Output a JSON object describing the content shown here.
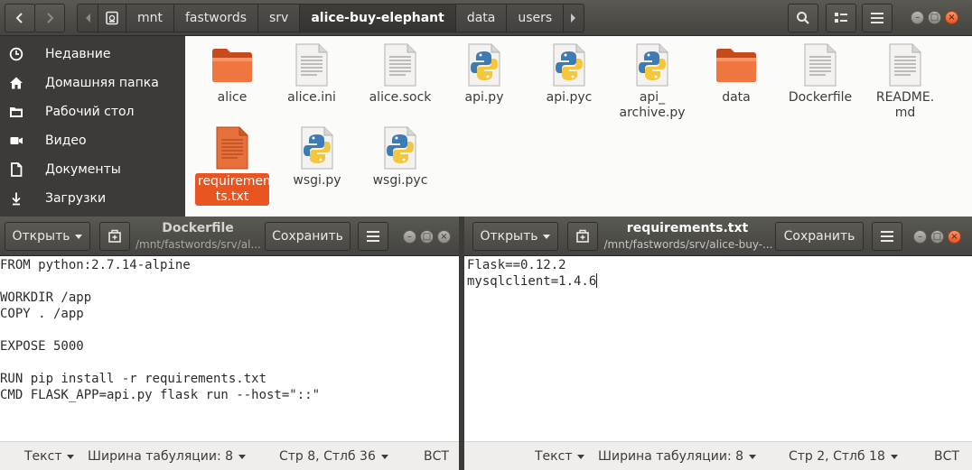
{
  "files_window": {
    "breadcrumbs": [
      "mnt",
      "fastwords",
      "srv",
      "alice-buy-elephant",
      "data",
      "users"
    ],
    "active_crumb": "alice-buy-elephant",
    "sidebar": [
      {
        "label": "Недавние",
        "icon": "clock-icon"
      },
      {
        "label": "Домашняя папка",
        "icon": "home-icon"
      },
      {
        "label": "Рабочий стол",
        "icon": "desktop-folder-icon"
      },
      {
        "label": "Видео",
        "icon": "video-icon"
      },
      {
        "label": "Документы",
        "icon": "document-icon"
      },
      {
        "label": "Загрузки",
        "icon": "download-icon"
      }
    ],
    "files": [
      {
        "name": "alice",
        "type": "folder"
      },
      {
        "name": "alice.ini",
        "type": "text"
      },
      {
        "name": "alice.sock",
        "type": "text"
      },
      {
        "name": "api.py",
        "type": "python"
      },
      {
        "name": "api.pyc",
        "type": "python"
      },
      {
        "name": "api_\narchive.py",
        "type": "python"
      },
      {
        "name": "data",
        "type": "folder"
      },
      {
        "name": "Dockerfile",
        "type": "text"
      },
      {
        "name": "README.\nmd",
        "type": "text"
      },
      {
        "name": "requiremen\nts.txt",
        "type": "text-selected"
      },
      {
        "name": "wsgi.py",
        "type": "python"
      },
      {
        "name": "wsgi.pyc",
        "type": "python"
      }
    ]
  },
  "editor_left": {
    "open_label": "Открыть",
    "save_label": "Сохранить",
    "title": "Dockerfile",
    "subtitle": "/mnt/fastwords/srv/al...",
    "content": "FROM python:2.7.14-alpine\n\nWORKDIR /app\nCOPY . /app\n\nEXPOSE 5000\n\nRUN pip install -r requirements.txt\nCMD FLASK_APP=api.py flask run --host=\"::\"",
    "status": {
      "syntax": "Текст",
      "tab_width": "Ширина табуляции: 8",
      "position": "Стр 8, Стлб 36",
      "mode": "ВСТ"
    }
  },
  "editor_right": {
    "open_label": "Открыть",
    "save_label": "Сохранить",
    "title": "requirements.txt",
    "subtitle": "/mnt/fastwords/srv/alice-buy-...",
    "content": "Flask==0.12.2\nmysqlclient=1.4.6",
    "status": {
      "syntax": "Текст",
      "tab_width": "Ширина табуляции: 8",
      "position": "Стр 2, Стлб 18",
      "mode": "ВСТ"
    }
  },
  "colors": {
    "accent": "#e95420",
    "titlebar": "#4a4945",
    "sidebar": "#3c3b37"
  }
}
